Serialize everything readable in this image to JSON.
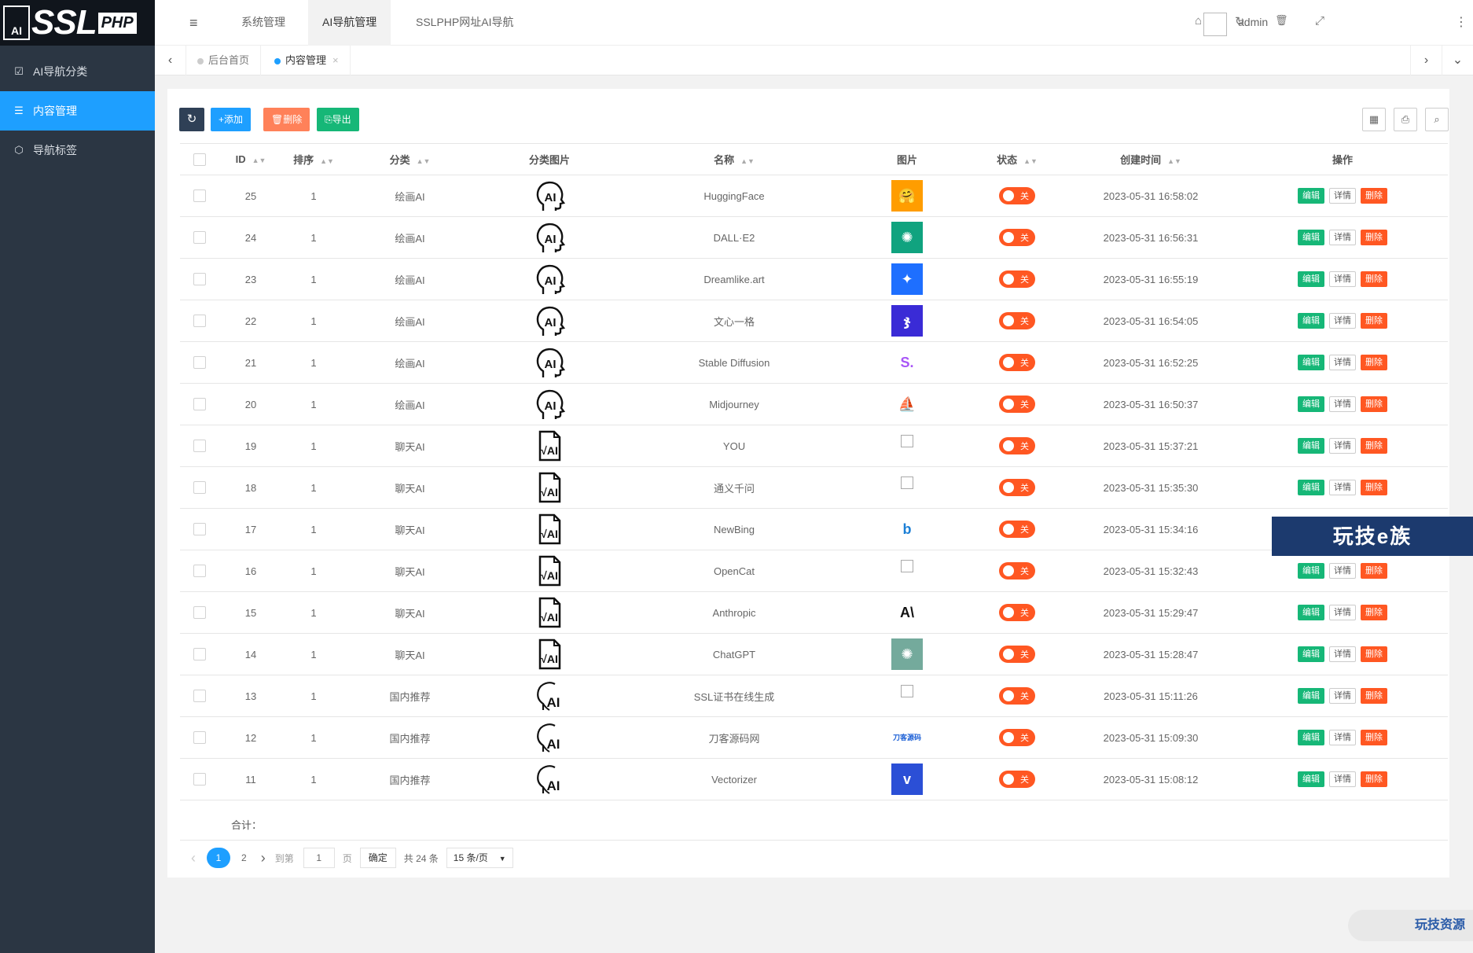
{
  "logo": {
    "badge": "AI",
    "text": "SSL",
    "suffix": "PHP"
  },
  "sidebar": {
    "items": [
      {
        "label": "AI导航分类",
        "icon": "calendar-check-icon",
        "glyph": "☑"
      },
      {
        "label": "内容管理",
        "icon": "list-icon",
        "glyph": "☰"
      },
      {
        "label": "导航标签",
        "icon": "tag-icon",
        "glyph": "⬡"
      }
    ]
  },
  "topbar": {
    "menu_icon": "≡",
    "tabs": [
      "系统管理",
      "AI导航管理",
      "SSLPHP网址AI导航"
    ],
    "home_icon": "⌂",
    "refresh_icon": "↻",
    "trash_icon": "🗑",
    "fullscreen_icon": "⤢",
    "username": "admin",
    "more_icon": "⋮"
  },
  "pagetabs": {
    "prev": "‹",
    "next": "›",
    "dropdown": "⌄",
    "items": [
      {
        "label": "后台首页"
      },
      {
        "label": "内容管理",
        "close": "×"
      }
    ]
  },
  "toolbar": {
    "refresh": "↻",
    "add_label": "+添加",
    "delete_label": "🗑删除",
    "export_label": "⎘导出",
    "columns_icon": "▦",
    "print_icon": "⎙",
    "search_icon": "⌕"
  },
  "table": {
    "headers": [
      "ID",
      "排序",
      "分类",
      "分类图片",
      "名称",
      "图片",
      "状态",
      "创建时间",
      "操作"
    ],
    "rows": [
      {
        "id": "25",
        "sort": "1",
        "category": "绘画AI",
        "cat_icon": "ai-head",
        "name": "HuggingFace",
        "img": {
          "kind": "logo",
          "text": "🤗",
          "bg": "#ff9d00"
        },
        "status": "关",
        "created": "2023-05-31 16:58:02"
      },
      {
        "id": "24",
        "sort": "1",
        "category": "绘画AI",
        "cat_icon": "ai-head",
        "name": "DALL·E2",
        "img": {
          "kind": "logo",
          "text": "✺",
          "bg": "#10a37f"
        },
        "status": "关",
        "created": "2023-05-31 16:56:31"
      },
      {
        "id": "23",
        "sort": "1",
        "category": "绘画AI",
        "cat_icon": "ai-head",
        "name": "Dreamlike.art",
        "img": {
          "kind": "logo",
          "text": "✦",
          "bg": "#1e6fff"
        },
        "status": "关",
        "created": "2023-05-31 16:55:19"
      },
      {
        "id": "22",
        "sort": "1",
        "category": "绘画AI",
        "cat_icon": "ai-head",
        "name": "文心一格",
        "img": {
          "kind": "logo",
          "text": "ჯ",
          "bg": "#3a2bd6"
        },
        "status": "关",
        "created": "2023-05-31 16:54:05"
      },
      {
        "id": "21",
        "sort": "1",
        "category": "绘画AI",
        "cat_icon": "ai-head",
        "name": "Stable Diffusion",
        "img": {
          "kind": "logo",
          "text": "S.",
          "bg": "#ffffff",
          "fg": "#a855f7"
        },
        "status": "关",
        "created": "2023-05-31 16:52:25"
      },
      {
        "id": "20",
        "sort": "1",
        "category": "绘画AI",
        "cat_icon": "ai-head",
        "name": "Midjourney",
        "img": {
          "kind": "logo",
          "text": "⛵",
          "bg": "#ffffff",
          "fg": "#222"
        },
        "status": "关",
        "created": "2023-05-31 16:50:37"
      },
      {
        "id": "19",
        "sort": "1",
        "category": "聊天AI",
        "cat_icon": "ai-doc",
        "name": "YOU",
        "img": {
          "kind": "broken"
        },
        "status": "关",
        "created": "2023-05-31 15:37:21"
      },
      {
        "id": "18",
        "sort": "1",
        "category": "聊天AI",
        "cat_icon": "ai-doc",
        "name": "通义千问",
        "img": {
          "kind": "broken"
        },
        "status": "关",
        "created": "2023-05-31 15:35:30"
      },
      {
        "id": "17",
        "sort": "1",
        "category": "聊天AI",
        "cat_icon": "ai-doc",
        "name": "NewBing",
        "img": {
          "kind": "logo",
          "text": "b",
          "bg": "#ffffff",
          "fg": "#1b7fd6"
        },
        "status": "关",
        "created": "2023-05-31 15:34:16"
      },
      {
        "id": "16",
        "sort": "1",
        "category": "聊天AI",
        "cat_icon": "ai-doc",
        "name": "OpenCat",
        "img": {
          "kind": "broken"
        },
        "status": "关",
        "created": "2023-05-31 15:32:43"
      },
      {
        "id": "15",
        "sort": "1",
        "category": "聊天AI",
        "cat_icon": "ai-doc",
        "name": "Anthropic",
        "img": {
          "kind": "logo",
          "text": "A\\",
          "bg": "#ffffff",
          "fg": "#111"
        },
        "status": "关",
        "created": "2023-05-31 15:29:47"
      },
      {
        "id": "14",
        "sort": "1",
        "category": "聊天AI",
        "cat_icon": "ai-doc",
        "name": "ChatGPT",
        "img": {
          "kind": "logo",
          "text": "✺",
          "bg": "#74aa9c"
        },
        "status": "关",
        "created": "2023-05-31 15:28:47"
      },
      {
        "id": "13",
        "sort": "1",
        "category": "国内推荐",
        "cat_icon": "ai-head2",
        "name": "SSL证书在线生成",
        "img": {
          "kind": "broken"
        },
        "status": "关",
        "created": "2023-05-31 15:11:26"
      },
      {
        "id": "12",
        "sort": "1",
        "category": "国内推荐",
        "cat_icon": "ai-head2",
        "name": "刀客源码网",
        "img": {
          "kind": "logo",
          "text": "刀客源码",
          "bg": "#ffffff",
          "fg": "#1b5fd6",
          "small": true
        },
        "status": "关",
        "created": "2023-05-31 15:09:30"
      },
      {
        "id": "11",
        "sort": "1",
        "category": "国内推荐",
        "cat_icon": "ai-head2",
        "name": "Vectorizer",
        "img": {
          "kind": "logo",
          "text": "v",
          "bg": "#2b4fd6"
        },
        "status": "关",
        "created": "2023-05-31 15:08:12"
      }
    ],
    "actions": {
      "edit": "编辑",
      "detail": "详情",
      "delete": "删除"
    }
  },
  "footer": {
    "total_label": "合计："
  },
  "pager": {
    "prev": "‹",
    "pages": [
      "1",
      "2"
    ],
    "current": "1",
    "next": "›",
    "goto_label": "到第",
    "goto_value": "1",
    "page_unit": "页",
    "confirm": "确定",
    "total": "共 24 条",
    "page_size": "15 条/页",
    "caret": "▼"
  },
  "ads": {
    "banner": "玩技e族",
    "corner": "玩技资源"
  }
}
